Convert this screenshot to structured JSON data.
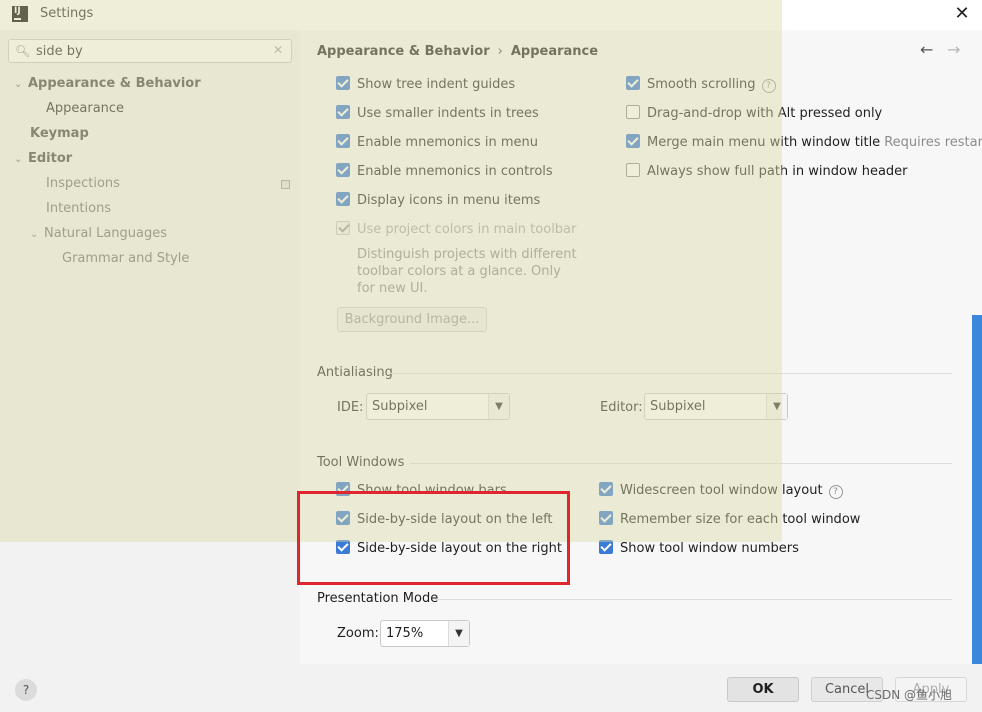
{
  "window": {
    "title": "Settings",
    "app_icon": "intellij-icon",
    "close_glyph": "✕"
  },
  "search": {
    "value": "side by",
    "icon": "🔍︎",
    "clear_glyph": "✕"
  },
  "tree": [
    {
      "label": "Appearance & Behavior",
      "chevron": "⌄"
    },
    {
      "label": "Appearance"
    },
    {
      "label": "Keymap"
    },
    {
      "label": "Editor",
      "chevron": "⌄"
    },
    {
      "label": "Inspections"
    },
    {
      "label": "Intentions"
    },
    {
      "label": "Natural Languages",
      "chevron": "⌄"
    },
    {
      "label": "Grammar and Style"
    }
  ],
  "breadcrumb": {
    "parent": "Appearance & Behavior",
    "separator": "›",
    "current": "Appearance"
  },
  "nav": {
    "back": "←",
    "forward": "→"
  },
  "appearance_options": {
    "left": [
      {
        "label": "Show tree indent guides",
        "checked": true
      },
      {
        "label": "Use smaller indents in trees",
        "checked": true
      },
      {
        "label": "Enable mnemonics in menu",
        "checked": true
      },
      {
        "label": "Enable mnemonics in controls",
        "checked": true
      },
      {
        "label": "Display icons in menu items",
        "checked": true
      },
      {
        "label": "Use project colors in main toolbar",
        "checked": true,
        "disabled": true
      }
    ],
    "right": [
      {
        "label": "Smooth scrolling",
        "checked": true,
        "help": "?"
      },
      {
        "label": "Drag-and-drop with Alt pressed only",
        "checked": false
      },
      {
        "label": "Merge main menu with window title",
        "checked": true,
        "hint": "Requires restart"
      },
      {
        "label": "Always show full path in window header",
        "checked": false
      }
    ],
    "description": "Distinguish projects with different toolbar colors at a glance. Only for new UI.",
    "background_button": "Background Image..."
  },
  "antialiasing": {
    "title": "Antialiasing",
    "ide_label": "IDE:",
    "ide_value": "Subpixel",
    "editor_label": "Editor:",
    "editor_value": "Subpixel"
  },
  "tool_windows": {
    "title": "Tool Windows",
    "left": [
      {
        "label": "Show tool window bars",
        "checked": true
      },
      {
        "label": "Side-by-side layout on the left",
        "checked": true
      },
      {
        "label": "Side-by-side layout on the right",
        "checked": true
      }
    ],
    "right": [
      {
        "label": "Widescreen tool window layout",
        "checked": true,
        "help": "?"
      },
      {
        "label": "Remember size for each tool window",
        "checked": true
      },
      {
        "label": "Show tool window numbers",
        "checked": true
      }
    ]
  },
  "presentation": {
    "title": "Presentation Mode",
    "zoom_label": "Zoom:",
    "zoom_value": "175%"
  },
  "footer": {
    "help": "?",
    "ok": "OK",
    "cancel": "Cancel",
    "apply": "Apply"
  },
  "watermark": "CSDN @鱼小旭",
  "colors": {
    "accent": "#3a7bd5",
    "highlight_box": "#e0262d",
    "overlay": "#dcdcaa"
  }
}
